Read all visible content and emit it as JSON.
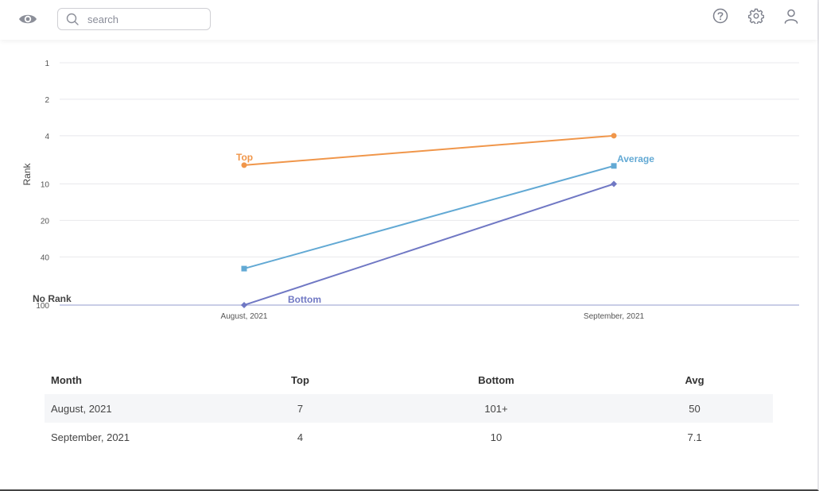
{
  "header": {
    "search_placeholder": "search",
    "icons": [
      "eye-icon",
      "help-icon",
      "gear-icon",
      "user-icon"
    ]
  },
  "chart_data": {
    "type": "line",
    "ylabel": "Rank",
    "x": [
      "August, 2021",
      "September, 2021"
    ],
    "y_ticks": [
      {
        "value": 1,
        "label": "1"
      },
      {
        "value": 2,
        "label": "2"
      },
      {
        "value": 4,
        "label": "4"
      },
      {
        "value": 10,
        "label": "10"
      },
      {
        "value": 20,
        "label": "20"
      },
      {
        "value": 40,
        "label": "40"
      },
      {
        "value": 100,
        "label": "100"
      }
    ],
    "y_scale": "log",
    "y_inverted": true,
    "no_rank_label": "No Rank",
    "grid": true,
    "series": [
      {
        "name": "Top",
        "color": "#f0964a",
        "marker": "circle",
        "values": [
          7,
          4
        ],
        "label_at": 0
      },
      {
        "name": "Average",
        "color": "#62a9d4",
        "marker": "square",
        "values": [
          50,
          7.1
        ],
        "label_at": 1
      },
      {
        "name": "Bottom",
        "color": "#7078c4",
        "marker": "diamond",
        "values": [
          100,
          10
        ],
        "label_at": 0
      }
    ]
  },
  "table": {
    "headers": [
      "Month",
      "Top",
      "Bottom",
      "Avg"
    ],
    "rows": [
      [
        "August, 2021",
        "7",
        "101+",
        "50"
      ],
      [
        "September, 2021",
        "4",
        "10",
        "7.1"
      ]
    ]
  }
}
